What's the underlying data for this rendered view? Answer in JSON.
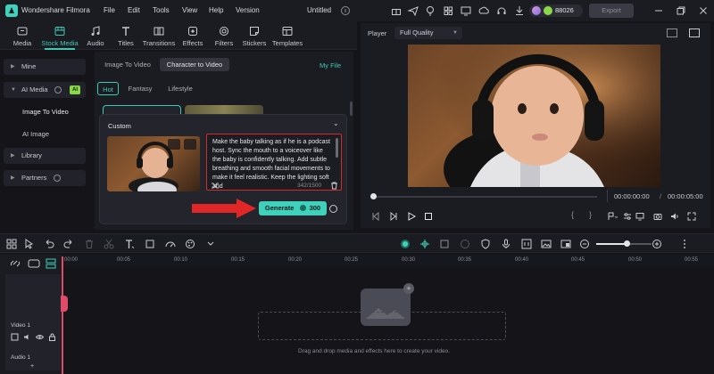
{
  "app": {
    "title": "Wondershare Filmora",
    "project": "Untitled",
    "credits": "88026",
    "export_label": "Export"
  },
  "menu": [
    "File",
    "Edit",
    "Tools",
    "View",
    "Help",
    "Version"
  ],
  "media_tools": [
    "Media",
    "Stock Media",
    "Audio",
    "Titles",
    "Transitions",
    "Effects",
    "Filters",
    "Stickers",
    "Templates"
  ],
  "sidebar": {
    "mine": "Mine",
    "ai_media": "AI Media",
    "ai_badge": "AI",
    "image_to_video": "Image To Video",
    "ai_image": "AI Image",
    "library": "Library",
    "partners": "Partners"
  },
  "content": {
    "tabs": [
      "Image To Video",
      "Character to Video"
    ],
    "my_file": "My File",
    "filters": [
      "Hot",
      "Fantasy",
      "Lifestyle"
    ],
    "custom_label": "Custom",
    "prompt_text": "Make the baby talking as if he is a podcast host. Sync the mouth to a voiceover like the baby is confidently talking. Add subtle breathing and smooth facial movements to make it feel realistic. Keep the lighting soft and",
    "char_count": "342/1500",
    "generate_label": "Generate",
    "generate_cost": "300"
  },
  "player": {
    "label": "Player",
    "quality": "Full Quality",
    "current_time": "00:00:00:00",
    "separator": "/",
    "total_time": "00:00:05:00"
  },
  "timeline": {
    "ticks": [
      "00:00",
      "00:05",
      "00:10",
      "00:15",
      "00:20",
      "00:25",
      "00:30",
      "00:35",
      "00:40",
      "00:45",
      "00:50",
      "00:55"
    ],
    "video_track": "Video 1",
    "audio_track": "Audio 1",
    "drop_hint": "Drag and drop media and effects here to create your video.",
    "zoom_level": 0.55
  },
  "colors": {
    "accent": "#3fd1bb",
    "highlight_red": "#d42a2a",
    "arrow_red": "#e02626",
    "playhead": "#e04b6a"
  }
}
